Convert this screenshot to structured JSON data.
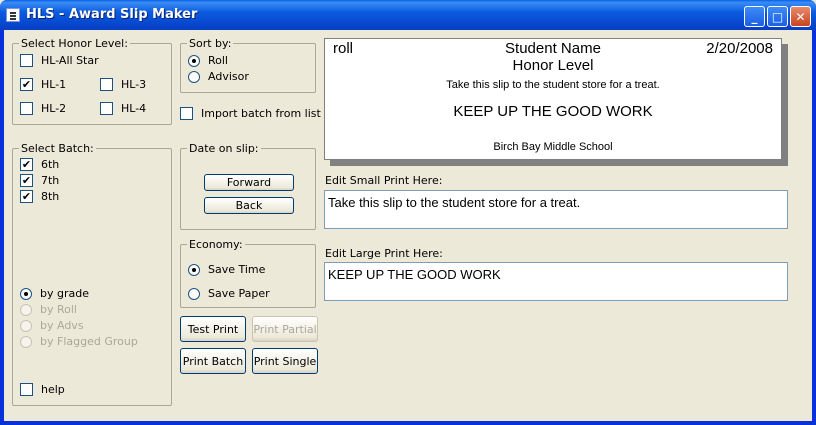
{
  "window": {
    "title": "HLS - Award Slip Maker",
    "min_glyph": "_",
    "max_glyph": "□",
    "close_glyph": "✕"
  },
  "honor": {
    "label": "Select Honor Level:",
    "options": [
      {
        "label": "HL-All Star",
        "checked": false
      },
      {
        "label": "HL-1",
        "checked": true
      },
      {
        "label": "HL-3",
        "checked": false
      },
      {
        "label": "HL-2",
        "checked": false
      },
      {
        "label": "HL-4",
        "checked": false
      }
    ]
  },
  "sort": {
    "label": "Sort by:",
    "options": [
      {
        "label": "Roll",
        "selected": true
      },
      {
        "label": "Advisor",
        "selected": false
      }
    ]
  },
  "import_batch": {
    "label": "Import batch from list",
    "checked": false
  },
  "batch": {
    "label": "Select Batch:",
    "items": [
      {
        "label": "6th",
        "checked": true
      },
      {
        "label": "7th",
        "checked": true
      },
      {
        "label": "8th",
        "checked": true
      }
    ],
    "group_by": [
      {
        "label": "by grade",
        "selected": true,
        "enabled": true
      },
      {
        "label": "by Roll",
        "selected": false,
        "enabled": false
      },
      {
        "label": "by Advs",
        "selected": false,
        "enabled": false
      },
      {
        "label": "by Flagged Group",
        "selected": false,
        "enabled": false
      }
    ],
    "help_label": "help"
  },
  "date_slip": {
    "label": "Date on slip:",
    "forward": "Forward",
    "back": "Back"
  },
  "economy": {
    "label": "Economy:",
    "options": [
      {
        "label": "Save Time",
        "selected": true
      },
      {
        "label": "Save Paper",
        "selected": false
      }
    ]
  },
  "buttons": {
    "test_print": "Test Print",
    "print_partial": "Print Partial",
    "print_batch": "Print Batch",
    "print_single": "Print Single"
  },
  "slip": {
    "roll": "roll",
    "student_name": "Student Name",
    "date": "2/20/2008",
    "honor_level": "Honor Level",
    "small_print": "Take this slip to the student store for a treat.",
    "large_print": "KEEP UP THE GOOD WORK",
    "school": "Birch Bay Middle School"
  },
  "edit_small": {
    "label": "Edit Small Print Here:",
    "value": "Take this slip to the student store for a treat."
  },
  "edit_large": {
    "label": "Edit Large Print Here:",
    "value": "KEEP UP THE GOOD WORK"
  }
}
